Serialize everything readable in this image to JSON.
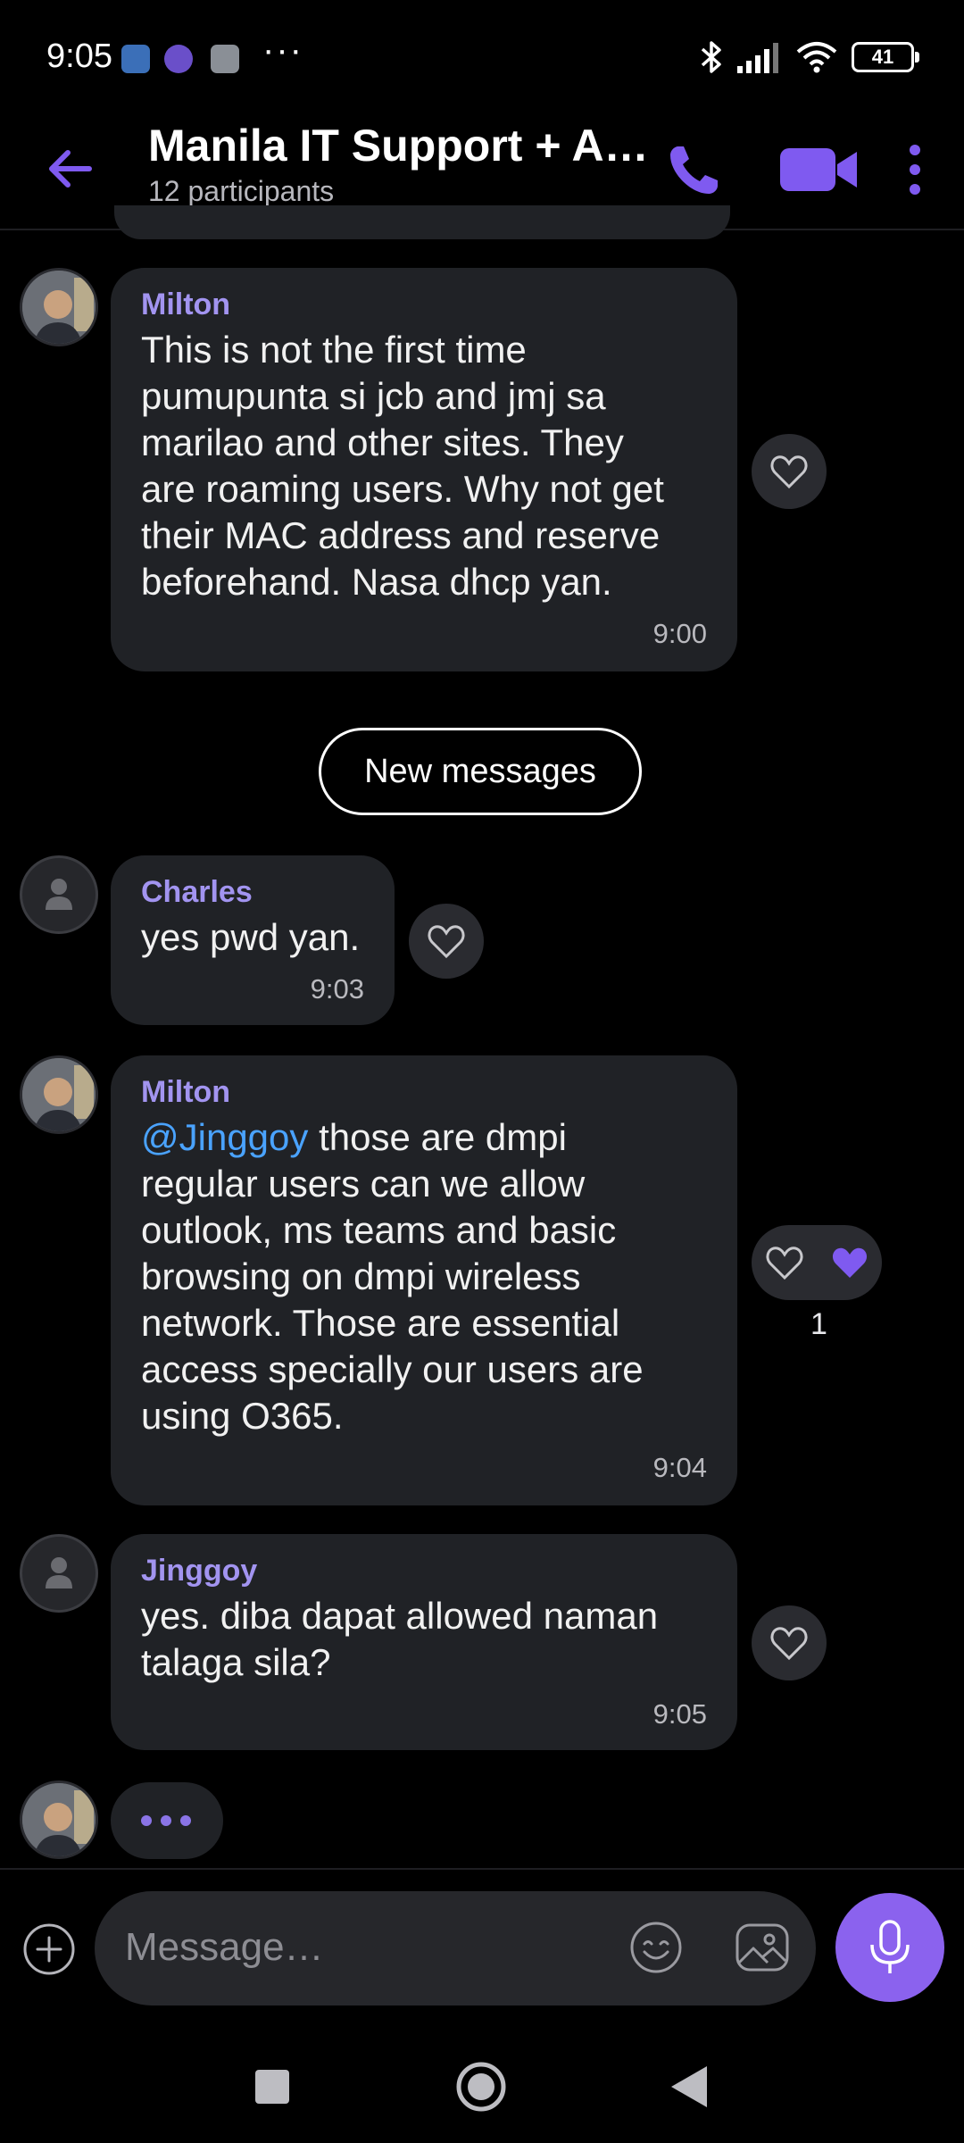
{
  "status_bar": {
    "time": "9:05",
    "battery": "41",
    "icons": [
      "message-icon",
      "viber-icon",
      "layers-icon",
      "more-icon",
      "bluetooth-icon",
      "signal-icon",
      "wifi-icon",
      "battery-icon"
    ],
    "dots": "···"
  },
  "header": {
    "title": "Manila IT Support + A…",
    "participants": "12 participants",
    "accent_color": "#7f5af0"
  },
  "messages": [
    {
      "sender": "Milton",
      "lines": [
        "This is not the first time",
        "pumupunta si jcb and jmj sa",
        "marilao and other sites. They",
        "are roaming users. Why not get",
        "their MAC address and reserve",
        "beforehand. Nasa dhcp yan."
      ],
      "time": "9:00"
    },
    {
      "sender": "Charles",
      "lines": [
        "yes pwd yan."
      ],
      "time": "9:03"
    },
    {
      "sender": "Milton",
      "mention": "@Jinggoy",
      "first_line_rest": " those are dmpi",
      "lines": [
        "regular users can we allow",
        "outlook, ms teams and basic",
        "browsing on dmpi wireless",
        "network. Those are essential",
        "access specially our users are",
        "using O365."
      ],
      "time": "9:04",
      "reaction_count": "1"
    },
    {
      "sender": "Jinggoy",
      "lines": [
        "yes.  diba dapat allowed naman",
        "talaga sila?"
      ],
      "time": "9:05"
    }
  ],
  "new_messages_label": "New messages",
  "input": {
    "placeholder": "Message…"
  }
}
